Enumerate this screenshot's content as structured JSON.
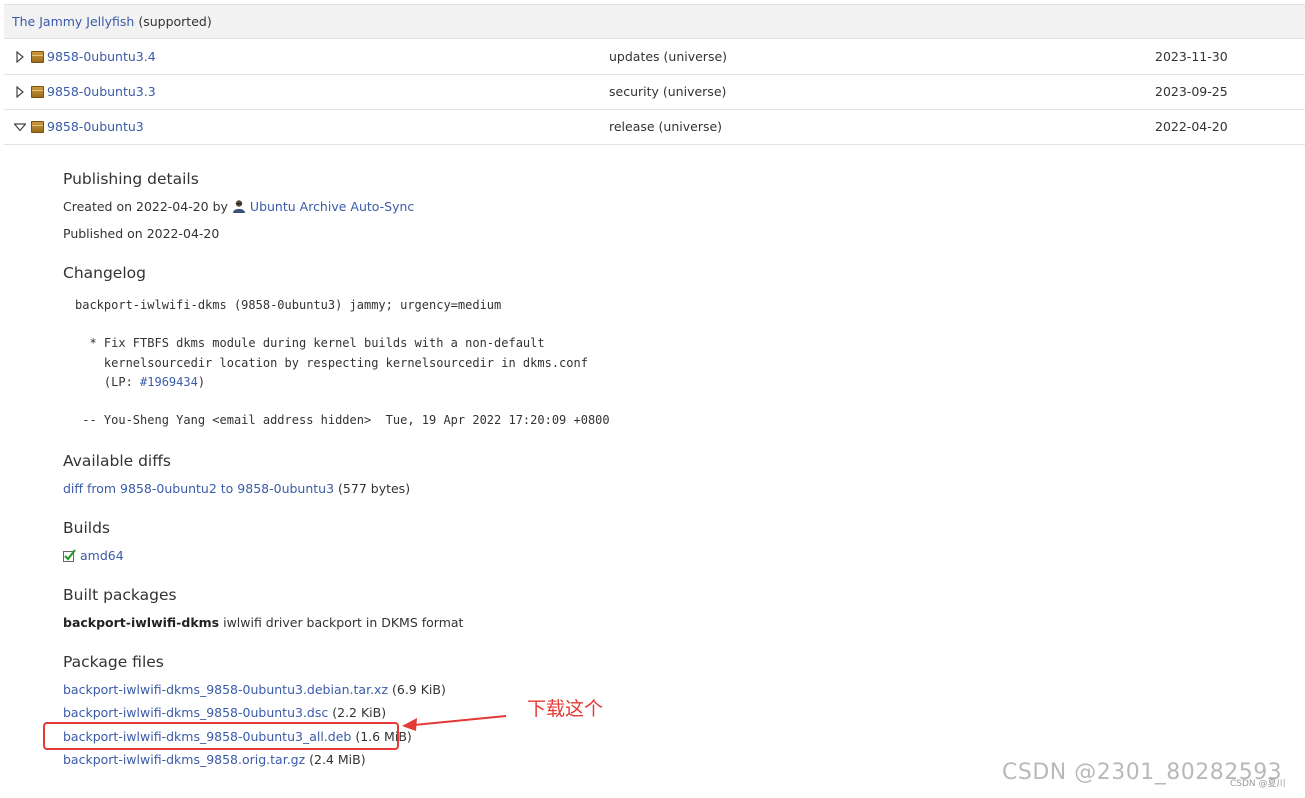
{
  "series": {
    "name": "The Jammy Jellyfish",
    "status": "(supported)"
  },
  "publications": [
    {
      "version": "9858-0ubuntu3.4",
      "pocket": "updates (universe)",
      "date": "2023-11-30",
      "expanded": false
    },
    {
      "version": "9858-0ubuntu3.3",
      "pocket": "security (universe)",
      "date": "2023-09-25",
      "expanded": false
    },
    {
      "version": "9858-0ubuntu3",
      "pocket": "release (universe)",
      "date": "2022-04-20",
      "expanded": true
    }
  ],
  "publishing": {
    "heading": "Publishing details",
    "created_prefix": "Created on 2022-04-20 by",
    "creator": "Ubuntu Archive Auto-Sync",
    "published": "Published on 2022-04-20"
  },
  "changelog": {
    "heading": "Changelog",
    "line1": "backport-iwlwifi-dkms (9858-0ubuntu3) jammy; urgency=medium",
    "line2": "  * Fix FTBFS dkms module during kernel builds with a non-default",
    "line3": "    kernelsourcedir location by respecting kernelsourcedir in dkms.conf",
    "line4_prefix": "    (LP: ",
    "bug": "#1969434",
    "line4_suffix": ")",
    "line5": " -- You-Sheng Yang <email address hidden>  Tue, 19 Apr 2022 17:20:09 +0800"
  },
  "diffs": {
    "heading": "Available diffs",
    "link": "diff from 9858-0ubuntu2 to 9858-0ubuntu3",
    "size": "(577 bytes)"
  },
  "builds": {
    "heading": "Builds",
    "arch": "amd64"
  },
  "built_packages": {
    "heading": "Built packages",
    "name": "backport-iwlwifi-dkms",
    "desc": "iwlwifi driver backport in DKMS format"
  },
  "package_files": {
    "heading": "Package files",
    "files": [
      {
        "name": "backport-iwlwifi-dkms_9858-0ubuntu3.debian.tar.xz",
        "size": "(6.9 KiB)"
      },
      {
        "name": "backport-iwlwifi-dkms_9858-0ubuntu3.dsc",
        "size": "(2.2 KiB)"
      },
      {
        "name": "backport-iwlwifi-dkms_9858-0ubuntu3_all.deb",
        "size": "(1.6 MiB)"
      },
      {
        "name": "backport-iwlwifi-dkms_9858.orig.tar.gz",
        "size": "(2.4 MiB)"
      }
    ]
  },
  "annotation": {
    "text": "下载这个",
    "color": "#e53935"
  },
  "watermark": {
    "main": "CSDN @2301_80282593",
    "small": "CSDN @夏川"
  }
}
